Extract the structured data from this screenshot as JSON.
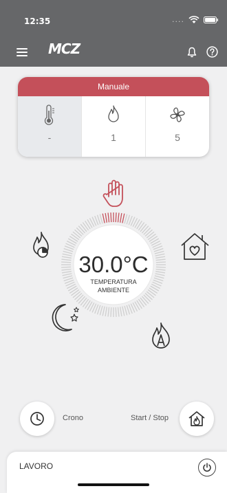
{
  "status_bar": {
    "time": "12:35",
    "signal": "...."
  },
  "nav": {
    "logo": "MCZ"
  },
  "mode_card": {
    "mode_label": "Manuale",
    "columns": [
      {
        "icon": "thermometer-icon",
        "value": "-"
      },
      {
        "icon": "flame-icon",
        "value": "1"
      },
      {
        "icon": "fan-icon",
        "value": "5"
      }
    ]
  },
  "dial": {
    "temperature": "30.0°C",
    "label_line1": "TEMPERATURA",
    "label_line2": "AMBIENTE"
  },
  "bottom": {
    "crono_label": "Crono",
    "start_stop_label": "Start / Stop"
  },
  "panel": {
    "title": "LAVORO"
  },
  "colors": {
    "header": "#666769",
    "accent": "#c4505a",
    "background": "#f0f0f1"
  }
}
